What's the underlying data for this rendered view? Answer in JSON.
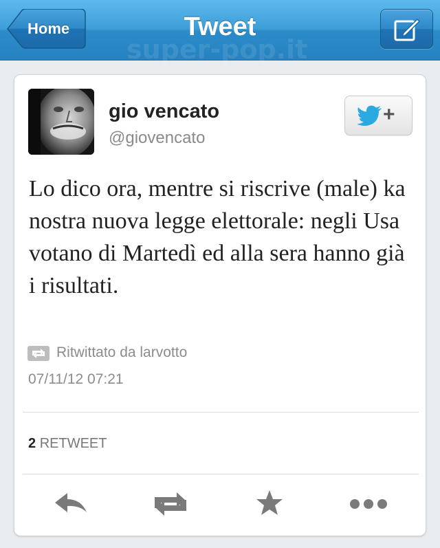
{
  "nav": {
    "back_label": "Home",
    "title": "Tweet",
    "watermark": "super-pop.it",
    "compose_icon": "compose-icon"
  },
  "tweet": {
    "author_name": "gio vencato",
    "author_handle": "@giovencato",
    "follow_icon": "twitter-bird-icon",
    "follow_plus": "+",
    "text": "Lo dico ora, mentre si riscrive (male) ka nostra nuova legge elettorale: negli Usa votano di Martedì ed alla sera hanno già i risultati.",
    "retweeted_by": "Ritwittato da larvotto",
    "timestamp": "07/11/12 07:21",
    "retweet_count": "2",
    "retweet_label": "RETWEET"
  },
  "actions": [
    {
      "name": "reply",
      "icon": "reply-icon"
    },
    {
      "name": "retweet",
      "icon": "retweet-icon"
    },
    {
      "name": "favorite",
      "icon": "star-icon"
    },
    {
      "name": "more",
      "icon": "more-icon"
    }
  ],
  "colors": {
    "nav_blue": "#2b8cc9",
    "twitter_blue": "#2ba9e1",
    "icon_gray": "#777777",
    "background": "#e9ecef"
  }
}
